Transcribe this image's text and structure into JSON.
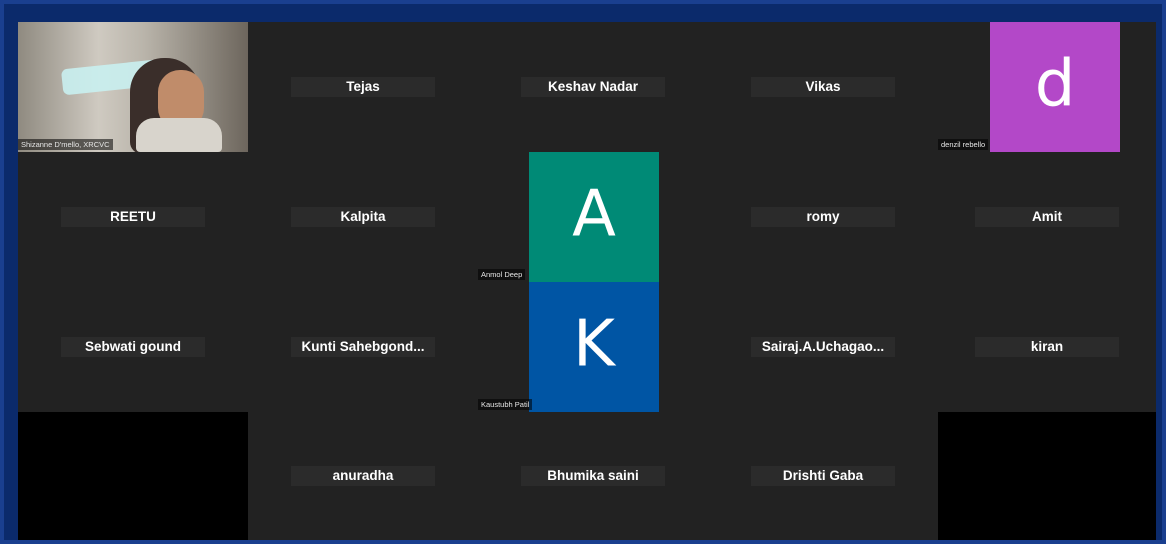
{
  "meeting": {
    "participants": [
      {
        "id": "shizanne",
        "label": "Shizanne D'mello, XRCVC"
      },
      {
        "id": "tejas",
        "label": "Tejas"
      },
      {
        "id": "keshav",
        "label": "Keshav Nadar"
      },
      {
        "id": "vikas",
        "label": "Vikas"
      },
      {
        "id": "denzil",
        "label": "denzil rebello",
        "avatar_letter": "d",
        "avatar_color": "#b348c8"
      },
      {
        "id": "reetu",
        "label": "REETU"
      },
      {
        "id": "kalpita",
        "label": "Kalpita"
      },
      {
        "id": "anmol",
        "label": "Anmol Deep",
        "avatar_letter": "A",
        "avatar_color": "#008a76"
      },
      {
        "id": "romy",
        "label": "romy"
      },
      {
        "id": "amit",
        "label": "Amit"
      },
      {
        "id": "sebwati",
        "label": "Sebwati gound"
      },
      {
        "id": "kunti",
        "label": "Kunti  Sahebgond..."
      },
      {
        "id": "kaustubh",
        "label": "Kaustubh Patil",
        "avatar_letter": "K",
        "avatar_color": "#0055a4"
      },
      {
        "id": "sairaj",
        "label": "Sairaj.A.Uchagao..."
      },
      {
        "id": "kiran",
        "label": "kiran"
      },
      {
        "id": "anuradha",
        "label": "anuradha"
      },
      {
        "id": "bhumika",
        "label": "Bhumika saini"
      },
      {
        "id": "drishti",
        "label": "Drishti Gaba"
      }
    ]
  }
}
